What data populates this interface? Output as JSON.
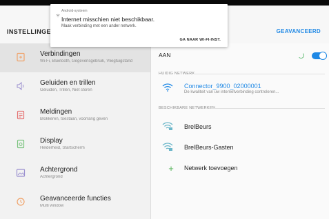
{
  "header": {
    "title": "INSTELLINGEN",
    "advanced_label": "GEAVANCEERD"
  },
  "notification": {
    "source": "Android-systeem",
    "title": "Internet misschien niet beschikbaar.",
    "body": "Maak verbinding met een ander netwerk.",
    "action": "GA NAAR WI-FI-INST."
  },
  "sidebar": {
    "items": [
      {
        "label": "Verbindingen",
        "sub": "Wi-Fi, Bluetooth, Gegevensgebruik, Vliegtuigstand",
        "icon": "connections-icon",
        "selected": true
      },
      {
        "label": "Geluiden en trillen",
        "sub": "Geluiden, Trillen, Niet storen",
        "icon": "sound-icon"
      },
      {
        "label": "Meldingen",
        "sub": "Blokkeren, toestaan, voorrang geven",
        "icon": "notifications-icon"
      },
      {
        "label": "Display",
        "sub": "Helderheid, Startscherm",
        "icon": "display-icon"
      },
      {
        "label": "Achtergrond",
        "sub": "Achtergrond",
        "icon": "wallpaper-icon"
      },
      {
        "label": "Geavanceerde functies",
        "sub": "Multi window",
        "icon": "advanced-features-icon"
      }
    ]
  },
  "wifi": {
    "state_label": "AAN",
    "enabled": true,
    "current_header": "HUIDIG NETWERK",
    "current": {
      "name": "Connector_9900_02000001",
      "status": "De kwaliteit van uw internetverbinding controleren..."
    },
    "available_header": "BESCHIKBARE NETWERKEN",
    "available": [
      {
        "name": "BrelBeurs"
      },
      {
        "name": "BrelBeurs-Gasten"
      }
    ],
    "add_network_label": "Netwerk toevoegen"
  },
  "colors": {
    "accent": "#1e88e5",
    "selected_bg": "#e3e3e3",
    "icon_orange": "#f0a36a",
    "icon_green": "#7bc47f"
  }
}
